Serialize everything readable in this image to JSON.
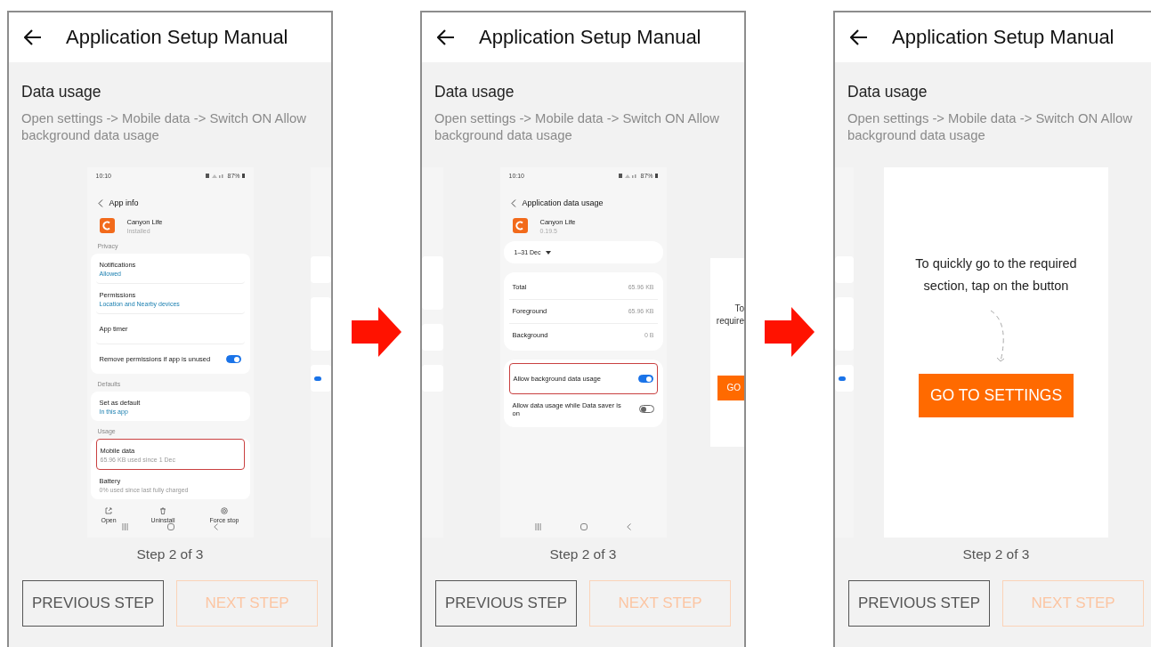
{
  "phones": [
    {
      "title": "Application Setup Manual",
      "section_title": "Data usage",
      "description": "Open settings -> Mobile data -> Switch ON Allow background data usage",
      "next_peek": {
        "kind": "data_usage"
      },
      "slide": {
        "kind": "app_info",
        "status_time": "10:10",
        "battery": "87%",
        "title": "App info",
        "app_name": "Canyon Life",
        "app_sub": "Installed",
        "groups": [
          {
            "heading": "Privacy",
            "items": [
              {
                "title": "Notifications",
                "sub": "Allowed",
                "sub_is_link": true,
                "highlighted": false
              },
              {
                "title": "Permissions",
                "sub": "Location and Nearby devices",
                "sub_is_link": true,
                "highlighted": false
              },
              {
                "title": "App timer",
                "highlighted": false
              },
              {
                "title": "Remove permissions if app is unused",
                "switch_on": true,
                "highlighted": false
              }
            ]
          },
          {
            "heading": "Defaults",
            "items": [
              {
                "title": "Set as default",
                "sub": "In this app",
                "sub_is_link": true,
                "highlighted": false
              }
            ]
          },
          {
            "heading": "Usage",
            "items": [
              {
                "title": "Mobile data",
                "sub": "65.96 KB used since 1 Dec",
                "sub_is_link": false,
                "highlighted": true
              },
              {
                "title": "Battery",
                "sub": "0% used since last fully charged",
                "sub_is_link": false,
                "highlighted": false
              }
            ]
          }
        ],
        "actions": [
          "Open",
          "Uninstall",
          "Force stop"
        ]
      },
      "step": "Step 2 of 3",
      "buttons": [
        {
          "label": "PREVIOUS STEP",
          "disabled": false
        },
        {
          "label": "NEXT STEP",
          "disabled": true
        }
      ]
    },
    {
      "title": "Application Setup Manual",
      "section_title": "Data usage",
      "description": "Open settings -> Mobile data -> Switch ON Allow background data usage",
      "prev_peek": {
        "kind": "app_info"
      },
      "next_peek": {
        "kind": "shortcut",
        "lines": [
          "To",
          "require"
        ],
        "button": "GO"
      },
      "slide": {
        "kind": "data_usage",
        "status_time": "10:10",
        "battery": "87%",
        "title": "Application data usage",
        "app_name": "Canyon Life",
        "app_sub": "0.19.5",
        "period": "1–31 Dec",
        "stats": [
          {
            "label": "Total",
            "value": "65.96 KB"
          },
          {
            "label": "Foreground",
            "value": "65.96 KB"
          },
          {
            "label": "Background",
            "value": "0 B"
          }
        ],
        "switches": [
          {
            "label": "Allow background data usage",
            "on": true,
            "highlighted": true
          },
          {
            "label": "Allow data usage while Data saver is on",
            "on": false,
            "highlighted": false
          }
        ]
      },
      "step": "Step 2 of 3",
      "buttons": [
        {
          "label": "PREVIOUS STEP",
          "disabled": false
        },
        {
          "label": "NEXT STEP",
          "disabled": true
        }
      ]
    },
    {
      "title": "Application Setup Manual",
      "section_title": "Data usage",
      "description": "Open settings -> Mobile data -> Switch ON Allow background data usage",
      "prev_peek": {
        "kind": "data_usage"
      },
      "slide": {
        "kind": "shortcut",
        "message": "To quickly go to the required section, tap on the button",
        "button": "GO TO SETTINGS"
      },
      "step": "Step 2 of 3",
      "buttons": [
        {
          "label": "PREVIOUS STEP",
          "disabled": false
        },
        {
          "label": "NEXT STEP",
          "disabled": true
        }
      ]
    }
  ]
}
